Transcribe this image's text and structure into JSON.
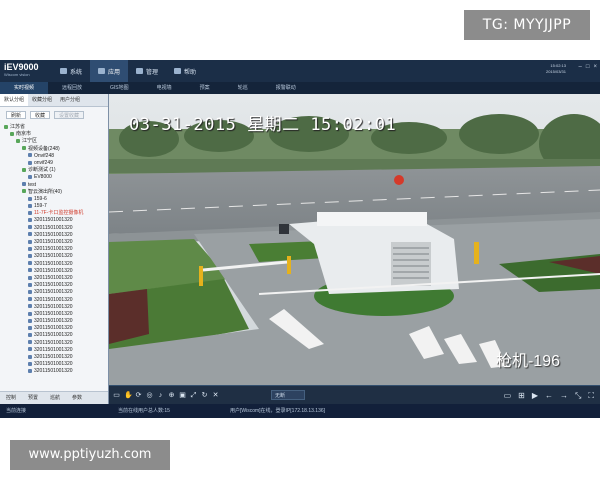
{
  "watermarks": {
    "top_right": "TG: MYYJJPP",
    "bottom_left": "www.pptiyuzh.com"
  },
  "app": {
    "logo": "iEV9000",
    "logo_sub": "Wiscom vision",
    "menu": [
      {
        "label": "系统",
        "icon": "system-icon"
      },
      {
        "label": "应用",
        "icon": "apps-icon",
        "active": true
      },
      {
        "label": "管理",
        "icon": "manage-icon"
      },
      {
        "label": "帮助",
        "icon": "help-icon"
      }
    ],
    "clock": {
      "time": "15:02:13",
      "date": "2015/03/31"
    },
    "sub_tabs": [
      "实时视频",
      "远程回放",
      "GIS地图",
      "电视墙",
      "预案",
      "轮巡",
      "报警联动"
    ],
    "sidebar": {
      "tabs": [
        "默认分组",
        "收藏分组",
        "用户分组"
      ],
      "tools": [
        "刷新",
        "收藏",
        "设置收藏"
      ],
      "tree": [
        {
          "label": "江苏省",
          "indent": 0,
          "kind": "folder"
        },
        {
          "label": "南京市",
          "indent": 1,
          "kind": "folder"
        },
        {
          "label": "江宁区",
          "indent": 2,
          "kind": "folder"
        },
        {
          "label": "视频设备(248)",
          "indent": 3,
          "kind": "folder"
        },
        {
          "label": "Onvif248",
          "indent": 4,
          "kind": "cam"
        },
        {
          "label": "onvif249",
          "indent": 4,
          "kind": "cam"
        },
        {
          "label": "诊断测试 (1)",
          "indent": 3,
          "kind": "folder"
        },
        {
          "label": "EV8000",
          "indent": 4,
          "kind": "cam"
        },
        {
          "label": "test",
          "indent": 3,
          "kind": "cam"
        },
        {
          "label": "智云演出所(40)",
          "indent": 3,
          "kind": "folder"
        },
        {
          "label": "159-6",
          "indent": 4,
          "kind": "cam"
        },
        {
          "label": "159-7",
          "indent": 4,
          "kind": "cam"
        },
        {
          "label": "11-7F-卡口监控摄像机",
          "indent": 4,
          "kind": "cam",
          "highlight": true
        },
        {
          "label": "32011501001320",
          "indent": 4,
          "kind": "cam"
        },
        {
          "label": "32011501001320",
          "indent": 4,
          "kind": "cam"
        },
        {
          "label": "32011501001320",
          "indent": 4,
          "kind": "cam"
        },
        {
          "label": "32011501001320",
          "indent": 4,
          "kind": "cam"
        },
        {
          "label": "32011501001320",
          "indent": 4,
          "kind": "cam"
        },
        {
          "label": "32011501001320",
          "indent": 4,
          "kind": "cam"
        },
        {
          "label": "32011501001320",
          "indent": 4,
          "kind": "cam"
        },
        {
          "label": "32011501001320",
          "indent": 4,
          "kind": "cam"
        },
        {
          "label": "32011501001320",
          "indent": 4,
          "kind": "cam"
        },
        {
          "label": "32011501001320",
          "indent": 4,
          "kind": "cam"
        },
        {
          "label": "32011501001320",
          "indent": 4,
          "kind": "cam"
        },
        {
          "label": "32011501001320",
          "indent": 4,
          "kind": "cam"
        },
        {
          "label": "32011501001320",
          "indent": 4,
          "kind": "cam"
        },
        {
          "label": "32011501001320",
          "indent": 4,
          "kind": "cam"
        },
        {
          "label": "32011501001320",
          "indent": 4,
          "kind": "cam"
        },
        {
          "label": "32011501001320",
          "indent": 4,
          "kind": "cam"
        },
        {
          "label": "32011501001320",
          "indent": 4,
          "kind": "cam"
        },
        {
          "label": "32011501001320",
          "indent": 4,
          "kind": "cam"
        },
        {
          "label": "32011501001320",
          "indent": 4,
          "kind": "cam"
        },
        {
          "label": "32011501001320",
          "indent": 4,
          "kind": "cam"
        },
        {
          "label": "32011501001320",
          "indent": 4,
          "kind": "cam"
        },
        {
          "label": "32011501001320",
          "indent": 4,
          "kind": "cam"
        }
      ],
      "bottom_tabs": [
        "控制",
        "预置",
        "巡航",
        "参数"
      ]
    },
    "video": {
      "osd_time": "03-31-2015 星期二 15:02:01",
      "osd_camera": "枪机-196"
    },
    "control_bar": {
      "select_label": "无断"
    },
    "status": {
      "left": "当前连接",
      "users": "当前在线用户总人数:15",
      "user_info": "用户[Wiscom]在线，登录IP[172.18.13.136]"
    }
  }
}
